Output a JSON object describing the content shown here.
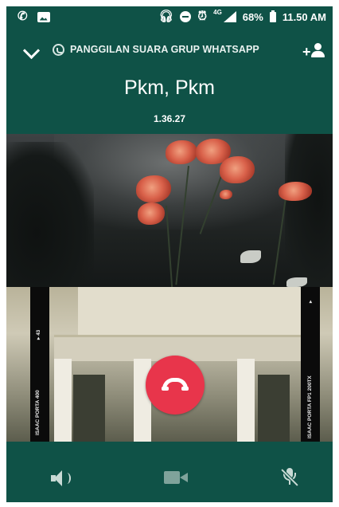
{
  "status_bar": {
    "left_icons": [
      "phone-icon",
      "image-icon"
    ],
    "right_icons": [
      "headphones-icon",
      "do-not-disturb-icon",
      "alarm-icon",
      "signal-icon",
      "battery-icon"
    ],
    "network": "4G",
    "battery_percent": "68%",
    "time": "11.50 AM"
  },
  "call": {
    "header_label": "PANGGILAN SUARA GRUP WHATSAPP",
    "name": "Pkm, Pkm",
    "duration": "1.36.27"
  },
  "video": {
    "strip_left_text": "ISAAC PORTA 400",
    "strip_left_num": "▸ 43",
    "strip_right_text": "ISAAC PORTA FP1 200TX",
    "strip_right_num": "▸"
  },
  "controls": {
    "buttons": [
      "speaker-icon",
      "video-camera-icon",
      "microphone-muted-icon"
    ]
  },
  "colors": {
    "primary": "#0f5247",
    "end_call": "#e8354b",
    "text": "#ffffff"
  }
}
